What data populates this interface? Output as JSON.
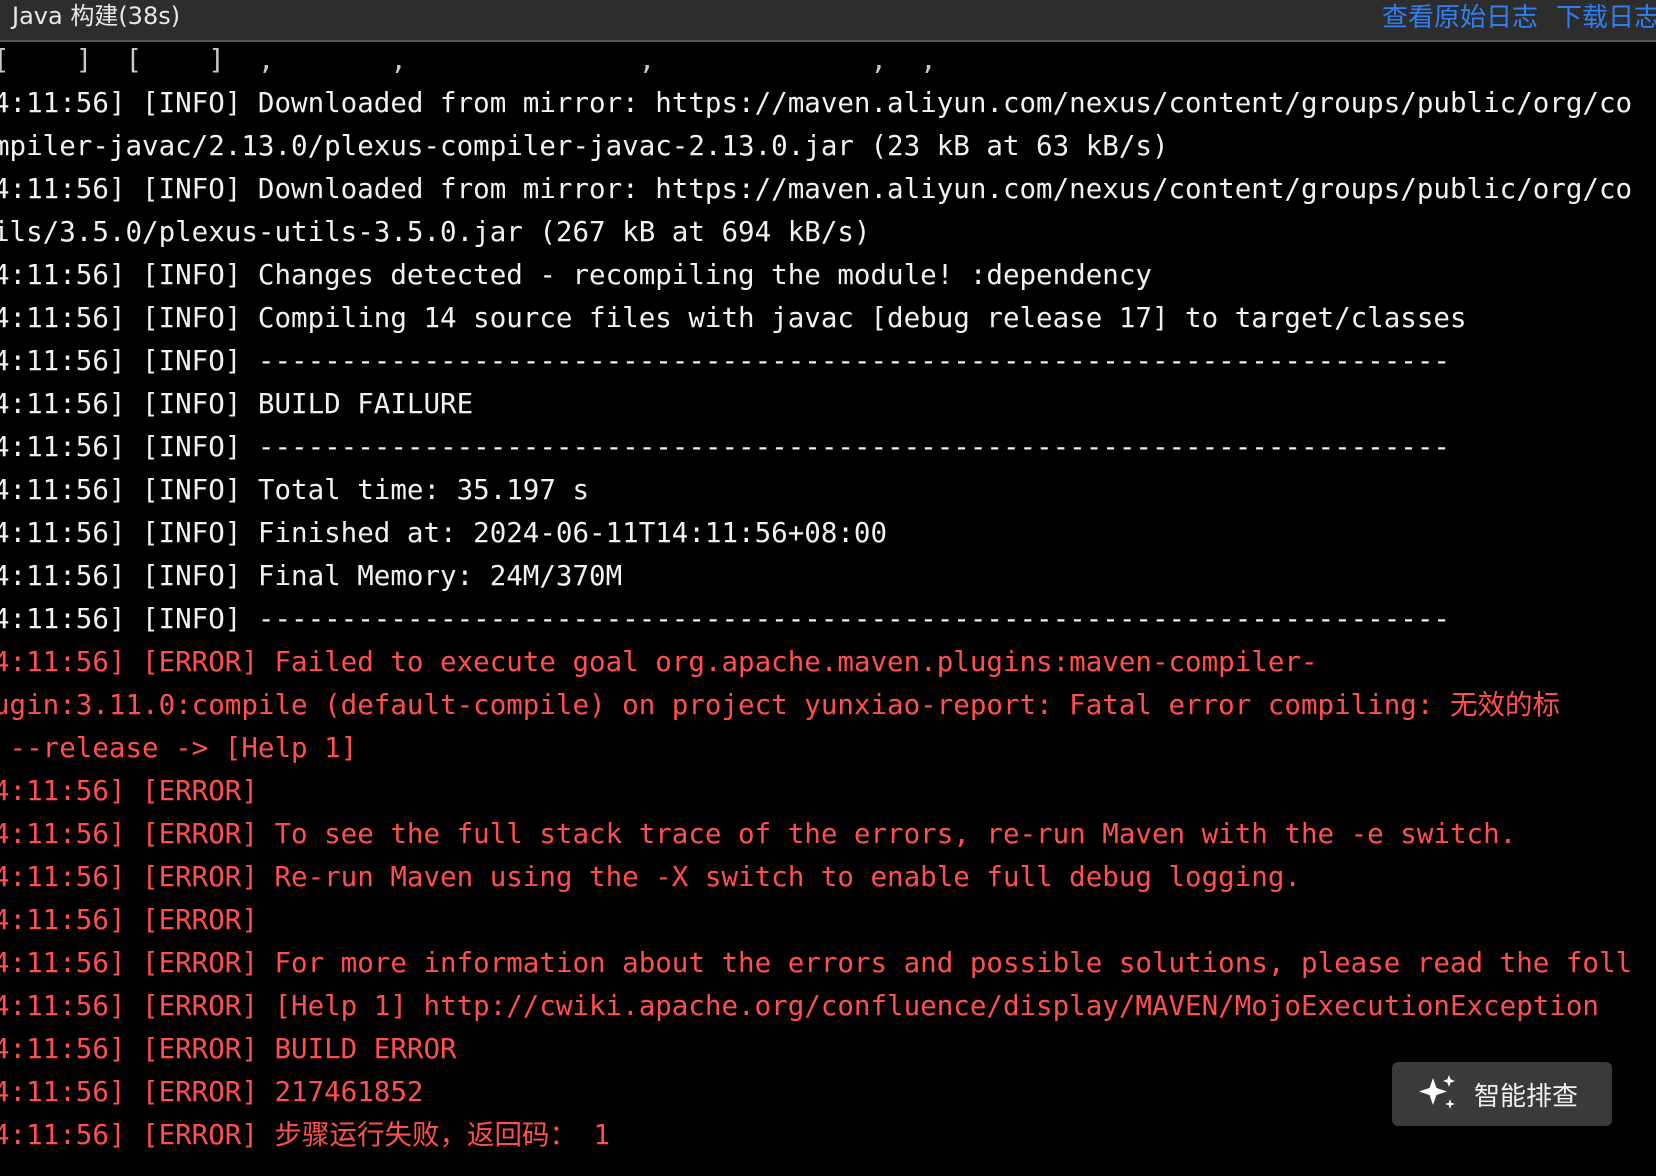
{
  "header": {
    "title": "Java 构建(38s)",
    "view_raw_log": "查看原始日志",
    "download_log": "下载日志"
  },
  "log_lines": [
    {
      "level": "partial",
      "text": "[    ]  [    ]  ,       ,              ,             ,  ,"
    },
    {
      "level": "info",
      "text": "4:11:56] [INFO] Downloaded from mirror: https://maven.aliyun.com/nexus/content/groups/public/org/co"
    },
    {
      "level": "info",
      "text": "mpiler-javac/2.13.0/plexus-compiler-javac-2.13.0.jar (23 kB at 63 kB/s)"
    },
    {
      "level": "info",
      "text": "4:11:56] [INFO] Downloaded from mirror: https://maven.aliyun.com/nexus/content/groups/public/org/co"
    },
    {
      "level": "info",
      "text": "ils/3.5.0/plexus-utils-3.5.0.jar (267 kB at 694 kB/s)"
    },
    {
      "level": "info",
      "text": "4:11:56] [INFO] Changes detected - recompiling the module! :dependency"
    },
    {
      "level": "info",
      "text": "4:11:56] [INFO] Compiling 14 source files with javac [debug release 17] to target/classes"
    },
    {
      "level": "info",
      "text": "4:11:56] [INFO] ------------------------------------------------------------------------"
    },
    {
      "level": "info",
      "text": "4:11:56] [INFO] BUILD FAILURE"
    },
    {
      "level": "info",
      "text": "4:11:56] [INFO] ------------------------------------------------------------------------"
    },
    {
      "level": "info",
      "text": "4:11:56] [INFO] Total time: 35.197 s"
    },
    {
      "level": "info",
      "text": "4:11:56] [INFO] Finished at: 2024-06-11T14:11:56+08:00"
    },
    {
      "level": "info",
      "text": "4:11:56] [INFO] Final Memory: 24M/370M"
    },
    {
      "level": "info",
      "text": "4:11:56] [INFO] ------------------------------------------------------------------------"
    },
    {
      "level": "error",
      "text": "4:11:56] [ERROR] Failed to execute goal org.apache.maven.plugins:maven-compiler-"
    },
    {
      "level": "error",
      "text": "ugin:3.11.0:compile (default-compile) on project yunxiao-report: Fatal error compiling: 无效的标"
    },
    {
      "level": "error",
      "text": " --release -> [Help 1]"
    },
    {
      "level": "error",
      "text": "4:11:56] [ERROR]"
    },
    {
      "level": "error",
      "text": "4:11:56] [ERROR] To see the full stack trace of the errors, re-run Maven with the -e switch."
    },
    {
      "level": "error",
      "text": "4:11:56] [ERROR] Re-run Maven using the -X switch to enable full debug logging."
    },
    {
      "level": "error",
      "text": "4:11:56] [ERROR]"
    },
    {
      "level": "error",
      "text": "4:11:56] [ERROR] For more information about the errors and possible solutions, please read the foll"
    },
    {
      "level": "error",
      "text": "4:11:56] [ERROR] [Help 1] http://cwiki.apache.org/confluence/display/MAVEN/MojoExecutionException"
    },
    {
      "level": "error",
      "text": "4:11:56] [ERROR] BUILD ERROR"
    },
    {
      "level": "error",
      "text": "4:11:56] [ERROR] 217461852"
    },
    {
      "level": "error",
      "text": "4:11:56] [ERROR] 步骤运行失败，返回码： 1"
    }
  ],
  "smart_button": {
    "label": "智能排查",
    "icon": "sparkle-icon"
  },
  "colors": {
    "background": "#000000",
    "header_background": "#2d2d2d",
    "info_text": "#f2f2f2",
    "error_text": "#ff4f4f",
    "link": "#2f7ff2"
  }
}
